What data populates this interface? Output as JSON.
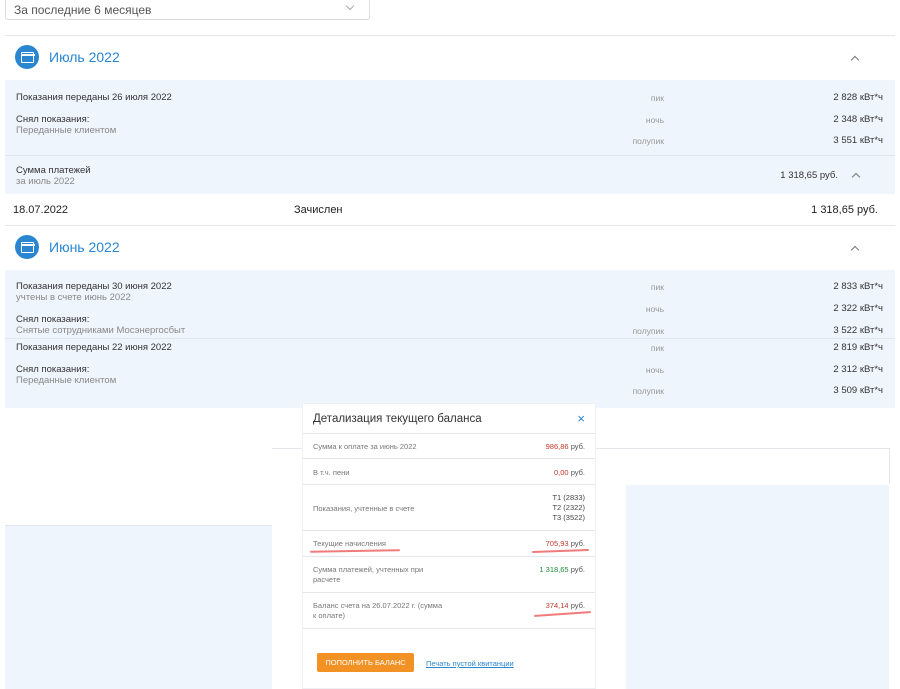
{
  "period_select": {
    "value": "За последние 6 месяцев"
  },
  "months": [
    {
      "title": "Июль 2022",
      "readings": [
        {
          "header": "Показания переданы 26 июля 2022",
          "note": "",
          "taken_by_label": "Снял показания:",
          "taken_by": "Переданные клиентом",
          "values": [
            {
              "tariff": "пик",
              "value": "2 828 кВт*ч"
            },
            {
              "tariff": "ночь",
              "value": "2 348 кВт*ч"
            },
            {
              "tariff": "полупик",
              "value": "3 551 кВт*ч"
            }
          ]
        }
      ],
      "payments_sum": {
        "label": "Сумма платежей",
        "period": "за июль 2022",
        "amount": "1 318,65 руб."
      },
      "payment_row": {
        "date": "18.07.2022",
        "status": "Зачислен",
        "amount": "1 318,65 руб."
      }
    },
    {
      "title": "Июнь 2022",
      "readings": [
        {
          "header": "Показания переданы 30 июня 2022",
          "note": "учтены в счете июнь 2022",
          "taken_by_label": "Снял показания:",
          "taken_by": "Снятые сотрудниками Мосэнергосбыт",
          "values": [
            {
              "tariff": "пик",
              "value": "2 833 кВт*ч"
            },
            {
              "tariff": "ночь",
              "value": "2 322 кВт*ч"
            },
            {
              "tariff": "полупик",
              "value": "3 522 кВт*ч"
            }
          ]
        },
        {
          "header": "Показания переданы 22 июня 2022",
          "note": "",
          "taken_by_label": "Снял показания:",
          "taken_by": "Переданные клиентом",
          "values": [
            {
              "tariff": "пик",
              "value": "2 819 кВт*ч"
            },
            {
              "tariff": "ночь",
              "value": "2 312 кВт*ч"
            },
            {
              "tariff": "полупик",
              "value": "3 509 кВт*ч"
            }
          ]
        }
      ]
    }
  ],
  "balance_modal": {
    "title": "Детализация текущего баланса",
    "close_symbol": "×",
    "rows": {
      "due_label": "Сумма к оплате за июнь 2022",
      "due_value": "986,86",
      "penalty_label": "В т.ч. пени",
      "penalty_value": "0,00",
      "readings_label": "Показания, учтенные в счете",
      "t1": "T1 (2833)",
      "t2": "T2 (2322)",
      "t3": "T3 (3522)",
      "charges_label": "Текущие начисления",
      "charges_value": "705,93",
      "payments_label": "Сумма платежей, учтенных при расчете",
      "payments_value": "1 318,65",
      "balance_label": "Баланс счета на 26.07.2022 г. (сумма к оплате)",
      "balance_value": "374,14",
      "currency": "руб."
    },
    "topup_button": "ПОПОЛНИТЬ БАЛАНС",
    "print_link": "Печать пустой квитанции"
  },
  "colors": {
    "accent": "#2a86d1",
    "panel_bg": "#eef5fc",
    "button": "#f39224",
    "negative": "#c0392b",
    "positive": "#1e8a3a"
  }
}
